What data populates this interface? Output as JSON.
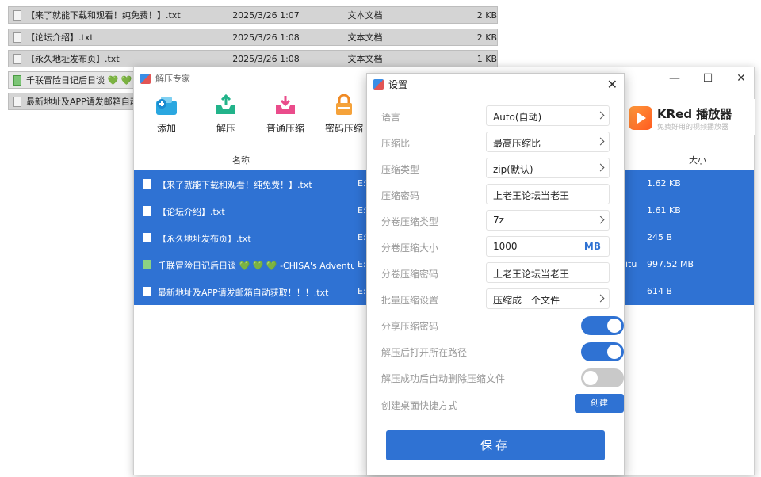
{
  "explorer": {
    "rows": [
      {
        "name": "【来了就能下载和观看！纯免费！】.txt",
        "date": "2025/3/26 1:07",
        "type": "文本文档",
        "size": "2 KB"
      },
      {
        "name": "【论坛介绍】.txt",
        "date": "2025/3/26 1:08",
        "type": "文本文档",
        "size": "2 KB"
      },
      {
        "name": "【永久地址发布页】.txt",
        "date": "2025/3/26 1:08",
        "type": "文本文档",
        "size": "1 KB"
      },
      {
        "name": "千联冒险日记后日谈 💚 💚",
        "date": "",
        "type": "",
        "size": ""
      },
      {
        "name": "最新地址及APP请发邮箱自动",
        "date": "",
        "type": "",
        "size": ""
      }
    ]
  },
  "main_window": {
    "title": "解压专家",
    "controls": {
      "minimize": "—",
      "maximize": "☐",
      "close": "✕"
    },
    "toolbar": [
      {
        "label": "添加",
        "icon": "add-archive-icon"
      },
      {
        "label": "解压",
        "icon": "extract-icon"
      },
      {
        "label": "普通压缩",
        "icon": "compress-icon"
      },
      {
        "label": "密码压缩",
        "icon": "password-compress-icon"
      }
    ],
    "ad": {
      "title": "KRed 播放器",
      "subtitle": "免费好用的视频播放器",
      "icon": "play-icon"
    },
    "columns": {
      "name": "名称",
      "size": "大小"
    },
    "files": [
      {
        "name": "【来了就能下载和观看！纯免费！】.txt",
        "path": "E:\\",
        "extra": "",
        "size": "1.62 KB",
        "icon": "file-icon"
      },
      {
        "name": "【论坛介绍】.txt",
        "path": "E:\\",
        "extra": "",
        "size": "1.61 KB",
        "icon": "file-icon"
      },
      {
        "name": "【永久地址发布页】.txt",
        "path": "E:\\",
        "extra": "",
        "size": "245 B",
        "icon": "file-icon"
      },
      {
        "name": "千联冒险日记后日谈 💚 💚 💚 -CHISA's Adventure",
        "path": "E:\\",
        "extra": "itu",
        "size": "997.52 MB",
        "icon": "image-file-icon"
      },
      {
        "name": "最新地址及APP请发邮箱自动获取！！！.txt",
        "path": "E:\\",
        "extra": "",
        "size": "614 B",
        "icon": "file-icon"
      }
    ]
  },
  "settings": {
    "title": "设置",
    "close": "✕",
    "fields": [
      {
        "label": "语言",
        "value": "Auto(自动)",
        "kind": "select"
      },
      {
        "label": "压缩比",
        "value": "最高压缩比",
        "kind": "select"
      },
      {
        "label": "压缩类型",
        "value": "zip(默认)",
        "kind": "select"
      },
      {
        "label": "压缩密码",
        "value": "上老王论坛当老王",
        "kind": "input"
      },
      {
        "label": "分卷压缩类型",
        "value": "7z",
        "kind": "select"
      },
      {
        "label": "分卷压缩大小",
        "value": "1000",
        "unit": "MB",
        "kind": "input"
      },
      {
        "label": "分卷压缩密码",
        "value": "上老王论坛当老王",
        "kind": "input"
      },
      {
        "label": "批量压缩设置",
        "value": "压缩成一个文件",
        "kind": "select"
      }
    ],
    "toggles": [
      {
        "label": "分享压缩密码",
        "on": true
      },
      {
        "label": "解压后打开所在路径",
        "on": true
      },
      {
        "label": "解压成功后自动删除压缩文件",
        "on": false
      }
    ],
    "shortcut": {
      "label": "创建桌面快捷方式",
      "button": "创建"
    },
    "save": "保存",
    "accent": "#2f72d3"
  }
}
